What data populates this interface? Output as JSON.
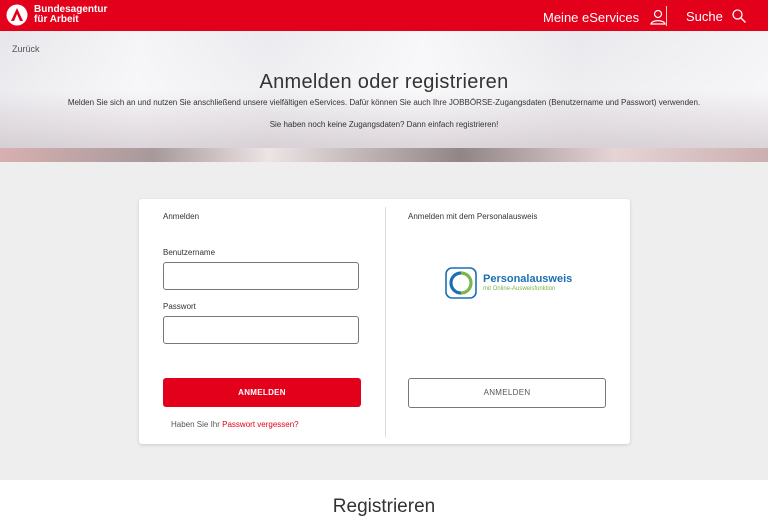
{
  "header": {
    "brand_line1": "Bundesagentur",
    "brand_line2": "für Arbeit",
    "nav_eservices": "Meine eServices",
    "nav_search": "Suche"
  },
  "hero": {
    "back_label": "Zurück",
    "title": "Anmelden oder registrieren",
    "text1": "Melden Sie sich an und nutzen Sie anschließend unsere vielfältigen eServices. Dafür können Sie auch Ihre JOBBÖRSE-Zugangsdaten (Benutzername und Passwort) verwenden.",
    "text2": "Sie haben noch keine Zugangsdaten? Dann einfach registrieren!"
  },
  "login": {
    "title": "Anmelden",
    "username_label": "Benutzername",
    "username_value": "",
    "password_label": "Passwort",
    "password_value": "",
    "submit_label": "ANMELDEN",
    "forgot_prefix": "Haben Sie Ihr ",
    "forgot_link": "Passwort vergessen?"
  },
  "id_login": {
    "title": "Anmelden mit dem Personalausweis",
    "logo_name": "Personalausweis",
    "logo_sub": "mit Online-Ausweisfunktion",
    "submit_label": "ANMELDEN"
  },
  "register": {
    "title": "Registrieren"
  },
  "colors": {
    "brand_red": "#e3001b",
    "link_red": "#e3001b",
    "pa_blue": "#1d6fb3",
    "pa_green": "#7ab648"
  }
}
